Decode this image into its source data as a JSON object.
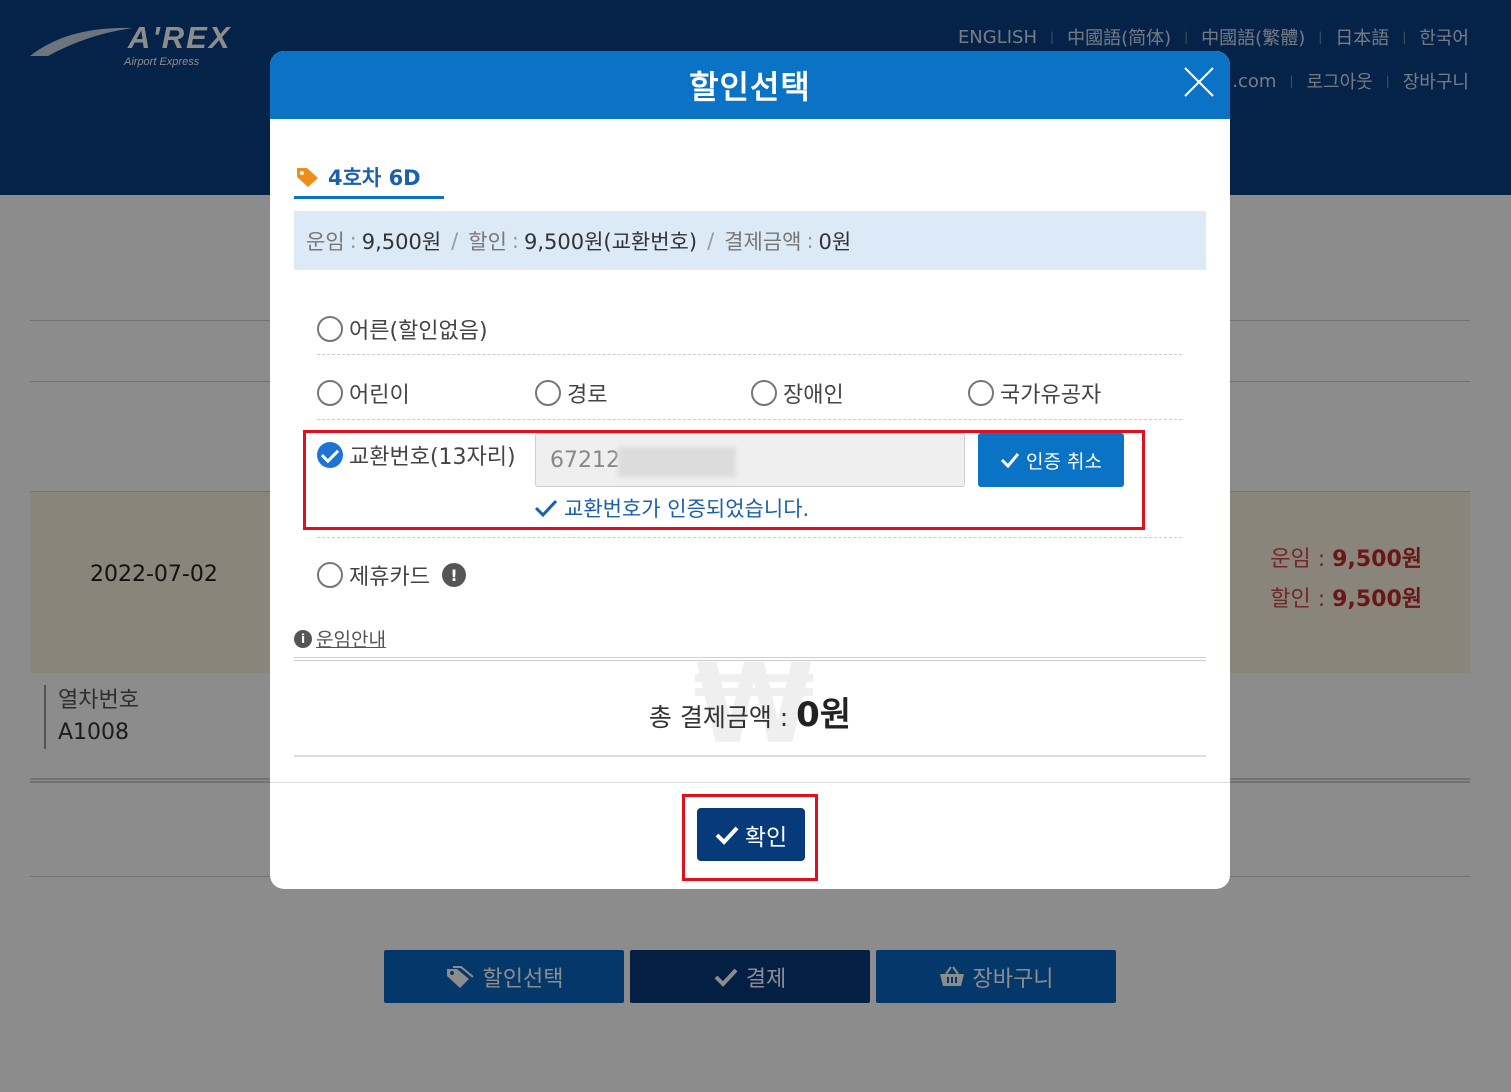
{
  "site": {
    "logo_text": "A'REX",
    "logo_sub": "Airport Express",
    "languages": [
      "ENGLISH",
      "中國語(简体)",
      "中國語(繁體)",
      "日本語",
      "한국어"
    ],
    "util_links": [
      ".com",
      "로그아웃",
      "장바구니"
    ]
  },
  "background": {
    "date": "2022-07-02",
    "fare_label": "운임 :",
    "fare_value": "9,500원",
    "discount_label": "할인 :",
    "discount_value": "9,500원",
    "train_label": "열차번호",
    "train_value": "A1008",
    "buttons": {
      "discount": "할인선택",
      "payment": "결제",
      "cart": "장바구니"
    }
  },
  "modal": {
    "title": "할인선택",
    "seat_tab": "4호차 6D",
    "summary": {
      "fare_key": "운임",
      "fare_val": "9,500원",
      "discount_key": "할인",
      "discount_val": "9,500원(교환번호)",
      "pay_key": "결제금액",
      "pay_val": "0원"
    },
    "options": {
      "adult": "어른(할인없음)",
      "child": "어린이",
      "senior": "경로",
      "disabled": "장애인",
      "veteran": "국가유공자",
      "exchange": "교환번호(13자리)",
      "partner_card": "제휴카드"
    },
    "exchange_input_value": "67212",
    "cancel_auth_label": "인증 취소",
    "auth_message": "교환번호가 인증되었습니다.",
    "fare_guide": "운임안내",
    "total_label": "총 결제금액 : ",
    "total_amount": "0원",
    "confirm_label": "확인"
  },
  "colors": {
    "header_blue": "#0b73c6",
    "navy": "#073a7a",
    "highlight_red": "#e0111f"
  }
}
